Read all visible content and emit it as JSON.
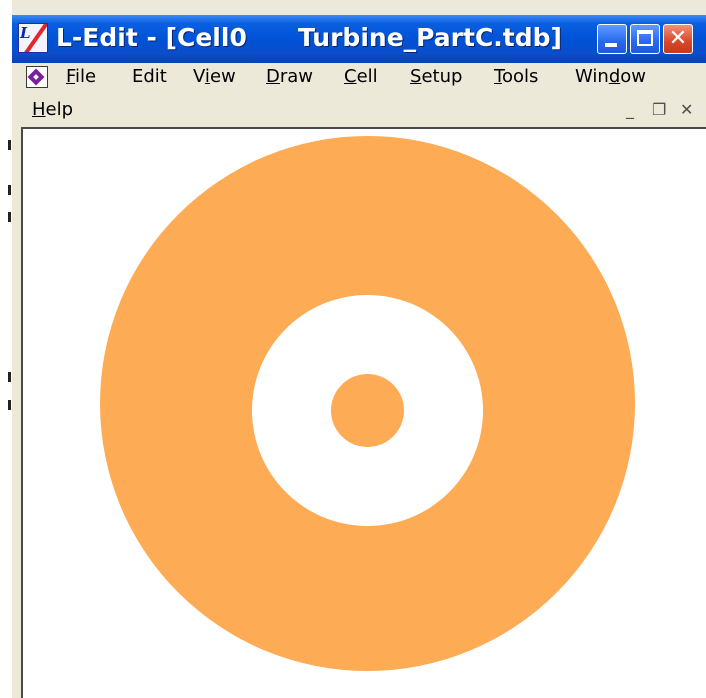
{
  "window": {
    "title_app": "L-Edit - [Cell0",
    "title_file": "Turbine_PartC.tdb]",
    "app_icon_text": "L"
  },
  "menu": {
    "items": [
      {
        "mnemonic": "F",
        "rest": "ile"
      },
      {
        "mnemonic": "",
        "rest": "Edit"
      },
      {
        "before": "V",
        "mnemonic": "i",
        "rest": "ew"
      },
      {
        "mnemonic": "D",
        "rest": "raw"
      },
      {
        "mnemonic": "C",
        "rest": "ell"
      },
      {
        "mnemonic": "S",
        "rest": "etup"
      },
      {
        "mnemonic": "T",
        "rest": "ools"
      },
      {
        "before": "Win",
        "mnemonic": "d",
        "rest": "ow"
      },
      {
        "mnemonic": "H",
        "rest": "elp"
      }
    ]
  },
  "mdi_controls": {
    "minimize_glyph": "_",
    "restore_glyph": "❐",
    "close_glyph": "✕"
  },
  "canvas": {
    "background": "#ffffff",
    "shapes": [
      {
        "name": "outer-ring",
        "color": "#fdab54"
      },
      {
        "name": "inner-hole",
        "color": "#ffffff"
      },
      {
        "name": "center-dot",
        "color": "#fdab54"
      }
    ]
  },
  "colors": {
    "layer_fill": "#fdab54",
    "titlebar": "#0a5fe0"
  },
  "icons": {
    "app": "l-edit-app-icon",
    "document": "document-icon",
    "minimize": "minimize-icon",
    "maximize": "maximize-icon",
    "close": "close-icon"
  }
}
